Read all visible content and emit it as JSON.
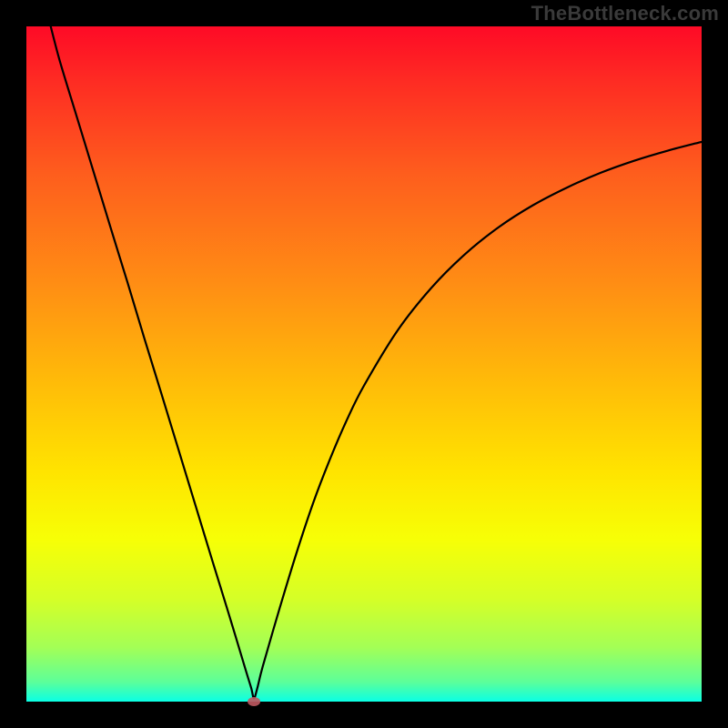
{
  "watermark": {
    "text": "TheBottleneck.com"
  },
  "gradient": {
    "top_color": "#fe0a26",
    "bottom_color": "#0affe5"
  },
  "chart_data": {
    "type": "line",
    "title": "",
    "xlabel": "",
    "ylabel": "",
    "xlim": [
      0,
      100
    ],
    "ylim": [
      0,
      100
    ],
    "grid": false,
    "marker": {
      "x": 33.7,
      "y": 0,
      "color": "#bf5961"
    },
    "series": [
      {
        "name": "curve",
        "x": [
          3.6,
          5,
          7.5,
          10,
          12.5,
          15,
          17.5,
          20,
          22.5,
          25,
          27.5,
          30,
          32.5,
          33.3,
          33.7,
          34.2,
          35,
          37.5,
          40,
          42.5,
          45,
          47.5,
          50,
          55,
          60,
          65,
          70,
          75,
          80,
          85,
          90,
          95,
          100
        ],
        "y": [
          100,
          94.7,
          86.5,
          78.3,
          70.1,
          62.0,
          53.7,
          45.6,
          37.4,
          29.2,
          21.0,
          12.9,
          4.6,
          2.0,
          0.5,
          2.0,
          5.2,
          13.8,
          22.0,
          29.5,
          36.0,
          41.8,
          46.8,
          55.0,
          61.3,
          66.3,
          70.3,
          73.5,
          76.1,
          78.3,
          80.1,
          81.6,
          82.9
        ]
      }
    ]
  }
}
